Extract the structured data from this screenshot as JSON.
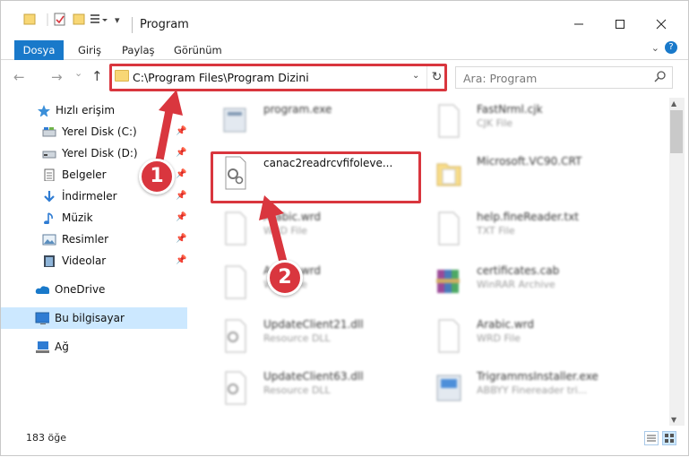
{
  "window": {
    "title": "Program",
    "minimize_icon": "minimize-icon",
    "maximize_icon": "maximize-icon",
    "close_icon": "close-icon"
  },
  "ribbon": {
    "tabs": [
      {
        "label": "Dosya",
        "active": true
      },
      {
        "label": "Giriş",
        "active": false
      },
      {
        "label": "Paylaş",
        "active": false
      },
      {
        "label": "Görünüm",
        "active": false
      }
    ],
    "help": "?"
  },
  "nav": {
    "back": "←",
    "forward": "→",
    "recent": "⌄",
    "up": "↑",
    "address": "C:\\Program Files\\Program Dizini",
    "address_dropdown": "⌄",
    "refresh": "↻",
    "search_placeholder": "Ara: Program",
    "search_icon": "⌕"
  },
  "sidebar": {
    "items": [
      {
        "label": "Hızlı erişim",
        "icon": "star-icon",
        "pinned": false
      },
      {
        "label": "Yerel Disk (C:)",
        "icon": "drive-icon",
        "pinned": true
      },
      {
        "label": "Yerel Disk (D:)",
        "icon": "drive-icon",
        "pinned": true
      },
      {
        "label": "Belgeler",
        "icon": "documents-icon",
        "pinned": true
      },
      {
        "label": "İndirmeler",
        "icon": "download-icon",
        "pinned": true
      },
      {
        "label": "Müzik",
        "icon": "music-icon",
        "pinned": true
      },
      {
        "label": "Resimler",
        "icon": "pictures-icon",
        "pinned": true
      },
      {
        "label": "Videolar",
        "icon": "videos-icon",
        "pinned": true
      },
      {
        "label": "OneDrive",
        "icon": "cloud-icon",
        "pinned": false
      },
      {
        "label": "Bu bilgisayar",
        "icon": "computer-icon",
        "pinned": false
      },
      {
        "label": "Ağ",
        "icon": "network-icon",
        "pinned": false
      }
    ]
  },
  "files": [
    {
      "name": "program.exe",
      "type": ""
    },
    {
      "name": "FastNrml.cjk",
      "type": "CJK File"
    },
    {
      "name": "canac2readrcvfifoleve...",
      "type": ""
    },
    {
      "name": "Microsoft.VC90.CRT",
      "type": ""
    },
    {
      "name": "Arabic.wrd",
      "type": "WRD File"
    },
    {
      "name": "help.fineReader.txt",
      "type": "TXT File"
    },
    {
      "name": "Arabic.wrd",
      "type": "WRD File"
    },
    {
      "name": "certificates.cab",
      "type": "WinRAR Archive"
    },
    {
      "name": "UpdateClient21.dll",
      "type": "Resource DLL"
    },
    {
      "name": "Arabic.wrd",
      "type": "WRD File"
    },
    {
      "name": "UpdateClient63.dll",
      "type": "Resource DLL"
    },
    {
      "name": "TrigrammsInstaller.exe",
      "type": "ABBYY Finereader tri..."
    }
  ],
  "status": {
    "count": "183 öğe"
  },
  "annotations": {
    "step1": "1",
    "step2": "2"
  },
  "colors": {
    "accent": "#1979ca",
    "highlight": "#d9363e",
    "selected": "#cce8ff"
  }
}
